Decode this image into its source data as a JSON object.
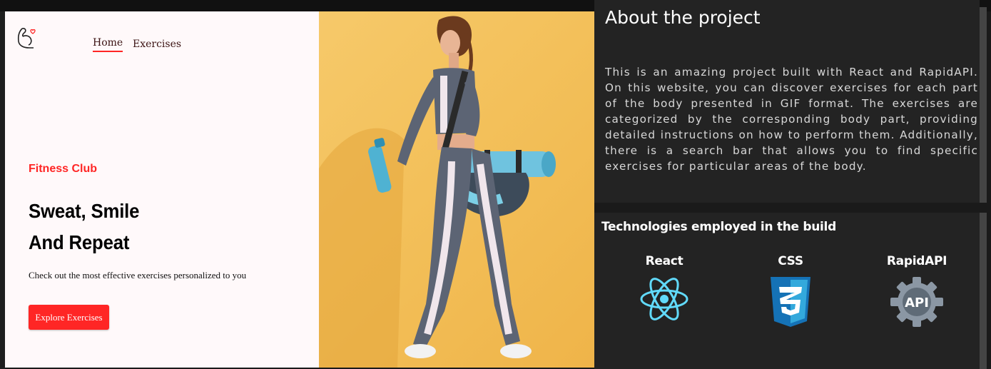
{
  "nav": {
    "home": "Home",
    "exercises": "Exercises"
  },
  "hero": {
    "eyebrow": "Fitness Club",
    "headline_line1": "Sweat, Smile",
    "headline_line2": "And Repeat",
    "subtitle": "Check out the most effective exercises personalized to you",
    "cta": "Explore Exercises"
  },
  "about": {
    "title": "About the project",
    "text": "This is an amazing project built with React and RapidAPI. On this website, you can discover exercises for each part of the body presented in GIF format. The exercises are categorized by the corresponding body part, providing detailed instructions on how to perform them. Additionally, there is a search bar that allows you to find specific exercises for particular areas of the body."
  },
  "technologies": {
    "title": "Technologies employed in the build",
    "items": [
      {
        "label": "React",
        "icon": "react-icon"
      },
      {
        "label": "CSS",
        "icon": "css3-icon"
      },
      {
        "label": "RapidAPI",
        "icon": "api-gear-icon",
        "badge": "API"
      }
    ]
  },
  "colors": {
    "accent": "#ff2625",
    "panel": "#232323",
    "hero_bg": "#fff9fa",
    "photo_bg": "#f3c05a"
  }
}
